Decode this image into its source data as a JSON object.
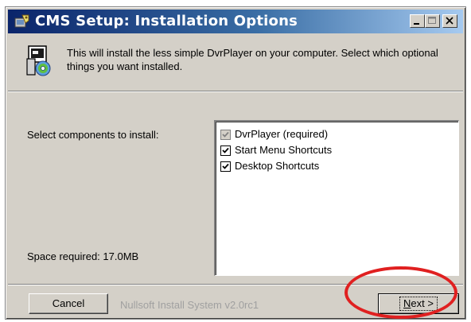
{
  "window": {
    "title": "CMS Setup: Installation Options",
    "controls": {
      "minimize_icon": "minimize-icon",
      "maximize_icon": "maximize-icon",
      "close_icon": "close-icon"
    }
  },
  "header": {
    "icon": "installer-icon",
    "description": "This will install the less simple DvrPlayer on your computer. Select which optional things you want installed."
  },
  "components": {
    "label": "Select components to install:",
    "items": [
      {
        "label": "DvrPlayer (required)",
        "checked": true,
        "disabled": true
      },
      {
        "label": "Start Menu Shortcuts",
        "checked": true,
        "disabled": false
      },
      {
        "label": "Desktop Shortcuts",
        "checked": true,
        "disabled": false
      }
    ]
  },
  "space_required": "Space required: 17.0MB",
  "footer": {
    "branding": "Nullsoft Install System v2.0rc1",
    "cancel_label": "Cancel",
    "next_mnemonic": "N",
    "next_rest": "ext >"
  },
  "colors": {
    "titlebar_start": "#0a246a",
    "titlebar_end": "#a6caf0",
    "dialog_face": "#d4d0c8",
    "annotation": "#e02020"
  }
}
